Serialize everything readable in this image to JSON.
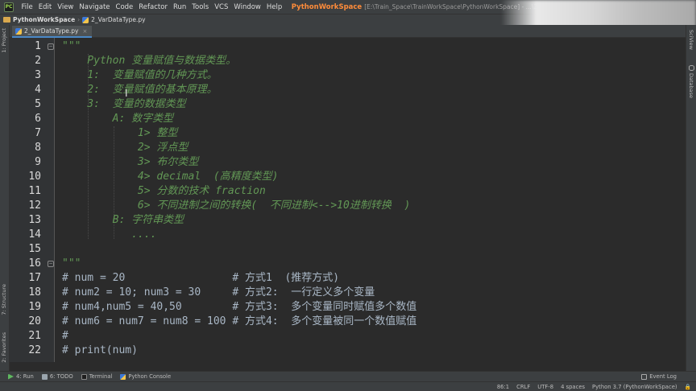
{
  "window": {
    "project_title": "PythonWorkSpace",
    "path_title": "[E:\\Train_Space\\TrainWorkSpace\\PythonWorkSpace] - ...\\2_VarDataType.py - P"
  },
  "menu": {
    "items": [
      "File",
      "Edit",
      "View",
      "Navigate",
      "Code",
      "Refactor",
      "Run",
      "Tools",
      "VCS",
      "Window",
      "Help"
    ]
  },
  "breadcrumb": {
    "project": "PythonWorkSpace",
    "file": "2_VarDataType.py"
  },
  "editor_tab": {
    "label": "2_VarDataType.py",
    "close": "×"
  },
  "left_tool_windows": [
    "1: Project",
    "7: Structure",
    "2: Favorites"
  ],
  "right_tool_windows": [
    "SciView",
    "Database"
  ],
  "code": {
    "line_numbers": [
      "1",
      "2",
      "3",
      "4",
      "5",
      "6",
      "7",
      "8",
      "9",
      "10",
      "11",
      "12",
      "13",
      "14",
      "15",
      "16",
      "17",
      "18",
      "19",
      "20",
      "21",
      "22"
    ],
    "lines": [
      "\"\"\"",
      "    Python 变量赋值与数据类型。",
      "    1:  变量赋值的几种方式。",
      "    2:  变量赋值的基本原理。",
      "    3:  变量的数据类型",
      "        A: 数字类型",
      "            1> 整型",
      "            2> 浮点型",
      "            3> 布尔类型",
      "            4> decimal  (高精度类型)",
      "            5> 分数的技术 fraction",
      "            6> 不同进制之间的转换(  不同进制<-->10进制转换  )",
      "        B: 字符串类型",
      "           ....",
      "",
      "\"\"\"",
      "# num = 20                 # 方式1  (推荐方式)",
      "# num2 = 10; num3 = 30     # 方式2:  一行定义多个变量",
      "# num4,num5 = 40,50        # 方式3:  多个变量同时赋值多个数值",
      "# num6 = num7 = num8 = 100 # 方式4:  多个变量被同一个数值赋值",
      "#",
      "# print(num)"
    ]
  },
  "bottom_tools": [
    "4: Run",
    "6: TODO",
    "Terminal",
    "Python Console"
  ],
  "event_log": "Event Log",
  "status": {
    "position": "86:1",
    "line_sep": "CRLF",
    "encoding": "UTF-8",
    "indent": "4 spaces",
    "interpreter": "Python 3.7 (PythonWorkSpace)"
  },
  "colors": {
    "docstring": "#629755",
    "comment": "#a9b7c6",
    "project_title": "#ff8c3a",
    "editor_bg": "#2b2b2b"
  }
}
